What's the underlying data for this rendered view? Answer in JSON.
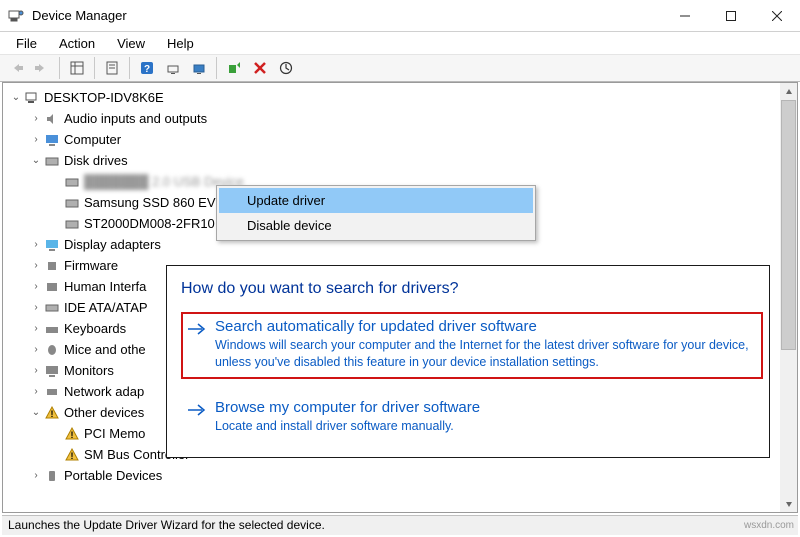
{
  "window": {
    "title": "Device Manager"
  },
  "menu": {
    "file": "File",
    "action": "Action",
    "view": "View",
    "help": "Help"
  },
  "tree": {
    "root": "DESKTOP-IDV8K6E",
    "audio": "Audio inputs and outputs",
    "computer": "Computer",
    "disk": "Disk drives",
    "disk_dev_a": "███████ 2.0 USB Device",
    "disk_dev_b": "Samsung SSD 860 EVO",
    "disk_dev_c": "ST2000DM008-2FR10",
    "display": "Display adapters",
    "firmware": "Firmware",
    "hid": "Human Interfa",
    "ide": "IDE ATA/ATAP",
    "keyboards": "Keyboards",
    "mice": "Mice and othe",
    "monitors": "Monitors",
    "netadapt": "Network adap",
    "other": "Other devices",
    "pci": "PCI Memo",
    "smbus": "SM Bus Controller",
    "portable": "Portable Devices"
  },
  "ctx": {
    "update": "Update driver",
    "disable": "Disable device"
  },
  "dialog": {
    "title": "How do you want to search for drivers?",
    "opt1_title": "Search automatically for updated driver software",
    "opt1_desc": "Windows will search your computer and the Internet for the latest driver software for your device, unless you've disabled this feature in your device installation settings.",
    "opt2_title": "Browse my computer for driver software",
    "opt2_desc": "Locate and install driver software manually."
  },
  "statusbar": "Launches the Update Driver Wizard for the selected device.",
  "watermark": "wsxdn.com"
}
